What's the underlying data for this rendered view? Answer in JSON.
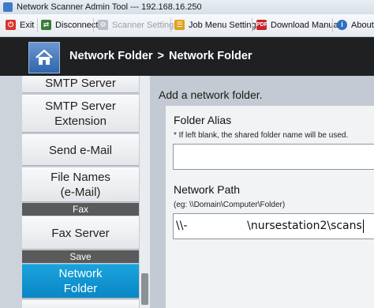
{
  "window": {
    "title": "Network Scanner Admin Tool  ---  192.168.16.250"
  },
  "toolbar": {
    "items": [
      {
        "label": "Exit",
        "icon": "exit-icon",
        "color": "#d9342b",
        "enabled": true
      },
      {
        "label": "Disconnect",
        "icon": "disconnect-icon",
        "color": "#3a7d3a",
        "enabled": true
      },
      {
        "label": "Scanner Settings",
        "icon": "scanner-settings-icon",
        "color": "#a8b0b8",
        "enabled": false
      },
      {
        "label": "Job Menu Settings",
        "icon": "job-menu-icon",
        "color": "#e0a020",
        "enabled": true
      },
      {
        "label": "Download Manual",
        "icon": "pdf-icon",
        "color": "#c8252a",
        "enabled": true
      },
      {
        "label": "About...",
        "icon": "info-icon",
        "color": "#2f6fc0",
        "enabled": true
      }
    ]
  },
  "header": {
    "home_icon": "home-icon",
    "breadcrumb": [
      "Network Folder",
      "Network Folder"
    ],
    "separator": ">"
  },
  "sidebar": {
    "items": [
      {
        "label": "SMTP Server",
        "type": "button"
      },
      {
        "label": "SMTP Server Extension",
        "type": "button"
      },
      {
        "label": "Send e-Mail",
        "type": "button"
      },
      {
        "label": "File Names (e-Mail)",
        "type": "button"
      },
      {
        "label": "Fax",
        "type": "section"
      },
      {
        "label": "Fax Server",
        "type": "button"
      },
      {
        "label": "Save",
        "type": "section"
      },
      {
        "label": "Network Folder",
        "type": "button",
        "active": true
      }
    ],
    "active_color": "#0a95d4"
  },
  "main": {
    "title": "Add a network folder.",
    "folder_alias": {
      "label": "Folder Alias",
      "hint": "* If left blank, the shared folder name will be used.",
      "value": ""
    },
    "network_path": {
      "label": "Network Path",
      "hint": "(eg: \\\\Domain\\Computer\\Folder)",
      "value": "\\\\-                 \\nursestation2\\scans"
    }
  }
}
